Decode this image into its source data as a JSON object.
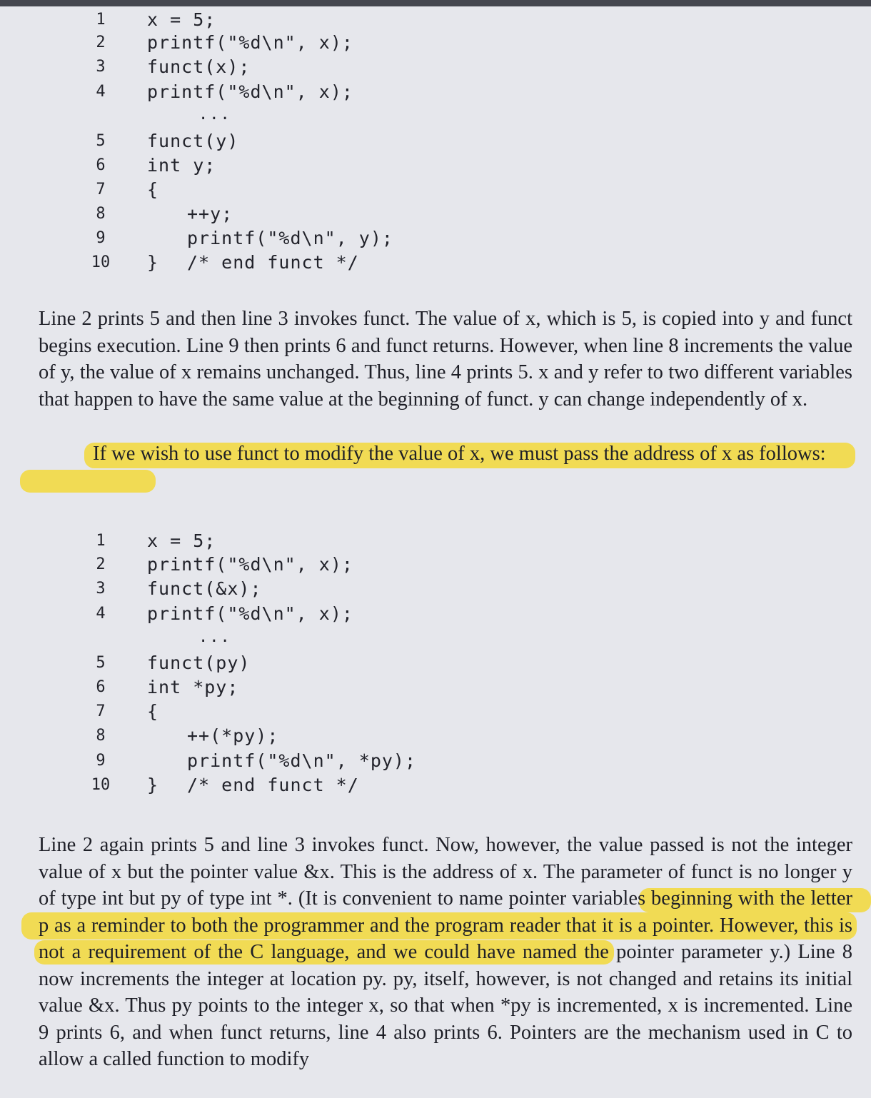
{
  "code_block_1": {
    "lines": [
      {
        "num": "1",
        "code": "x = 5;"
      },
      {
        "num": "2",
        "code": "printf(\"%d\\n\", x);"
      },
      {
        "num": "3",
        "code": "funct(x);"
      },
      {
        "num": "4",
        "code": "printf(\"%d\\n\", x);"
      },
      {
        "num": "5",
        "code": "funct(y)"
      },
      {
        "num": "6",
        "code": "int y;"
      },
      {
        "num": "7",
        "code": "{"
      },
      {
        "num": "8",
        "code": "++y;"
      },
      {
        "num": "9",
        "code": "printf(\"%d\\n\", y);"
      },
      {
        "num": "10",
        "code": "}"
      }
    ],
    "end_comment": "/* end funct */",
    "ellipsis": "..."
  },
  "paragraph_1": "Line 2 prints 5 and then line 3 invokes funct. The value of x, which is 5, is copied into y and funct begins execution. Line 9 then prints 6 and funct returns. However, when line 8 increments the value of y, the value of x remains unchanged. Thus, line 4 prints 5. x and y refer to two different variables that happen to have the same value at the beginning of funct. y can change independently of x.",
  "paragraph_2": "If we wish to use funct to modify the value of x, we must pass the address of x as follows:",
  "code_block_2": {
    "lines": [
      {
        "num": "1",
        "code": "x = 5;"
      },
      {
        "num": "2",
        "code": "printf(\"%d\\n\", x);"
      },
      {
        "num": "3",
        "code": "funct(&x);"
      },
      {
        "num": "4",
        "code": "printf(\"%d\\n\", x);"
      },
      {
        "num": "5",
        "code": "funct(py)"
      },
      {
        "num": "6",
        "code": "int *py;"
      },
      {
        "num": "7",
        "code": "{"
      },
      {
        "num": "8",
        "code": "++(*py);"
      },
      {
        "num": "9",
        "code": "printf(\"%d\\n\", *py);"
      },
      {
        "num": "10",
        "code": "}"
      }
    ],
    "end_comment": "/* end funct */",
    "ellipsis": "..."
  },
  "paragraph_3": "Line 2 again prints 5 and line 3 invokes funct. Now, however, the value passed is not the integer value of x but the pointer value &x. This is the address of x. The parameter of funct is no longer y of type int but py of type int *. (It is convenient to name pointer variables beginning with the letter p as a reminder to both the programmer and the program reader that it is a pointer. However, this is not a requirement of the C language, and we could have named the pointer parameter y.) Line 8 now increments the integer at location py. py, itself, however, is not changed and retains its initial value &x. Thus py points to the integer x, so that when *py is incremented, x is incremented. Line 9 prints 6, and when funct returns, line 4 also prints 6. Pointers are the mechanism used in C to allow a called function to modify",
  "colors": {
    "highlight": "#f2d83a",
    "page": "#e6e7ec",
    "ink": "#1e1f27"
  }
}
